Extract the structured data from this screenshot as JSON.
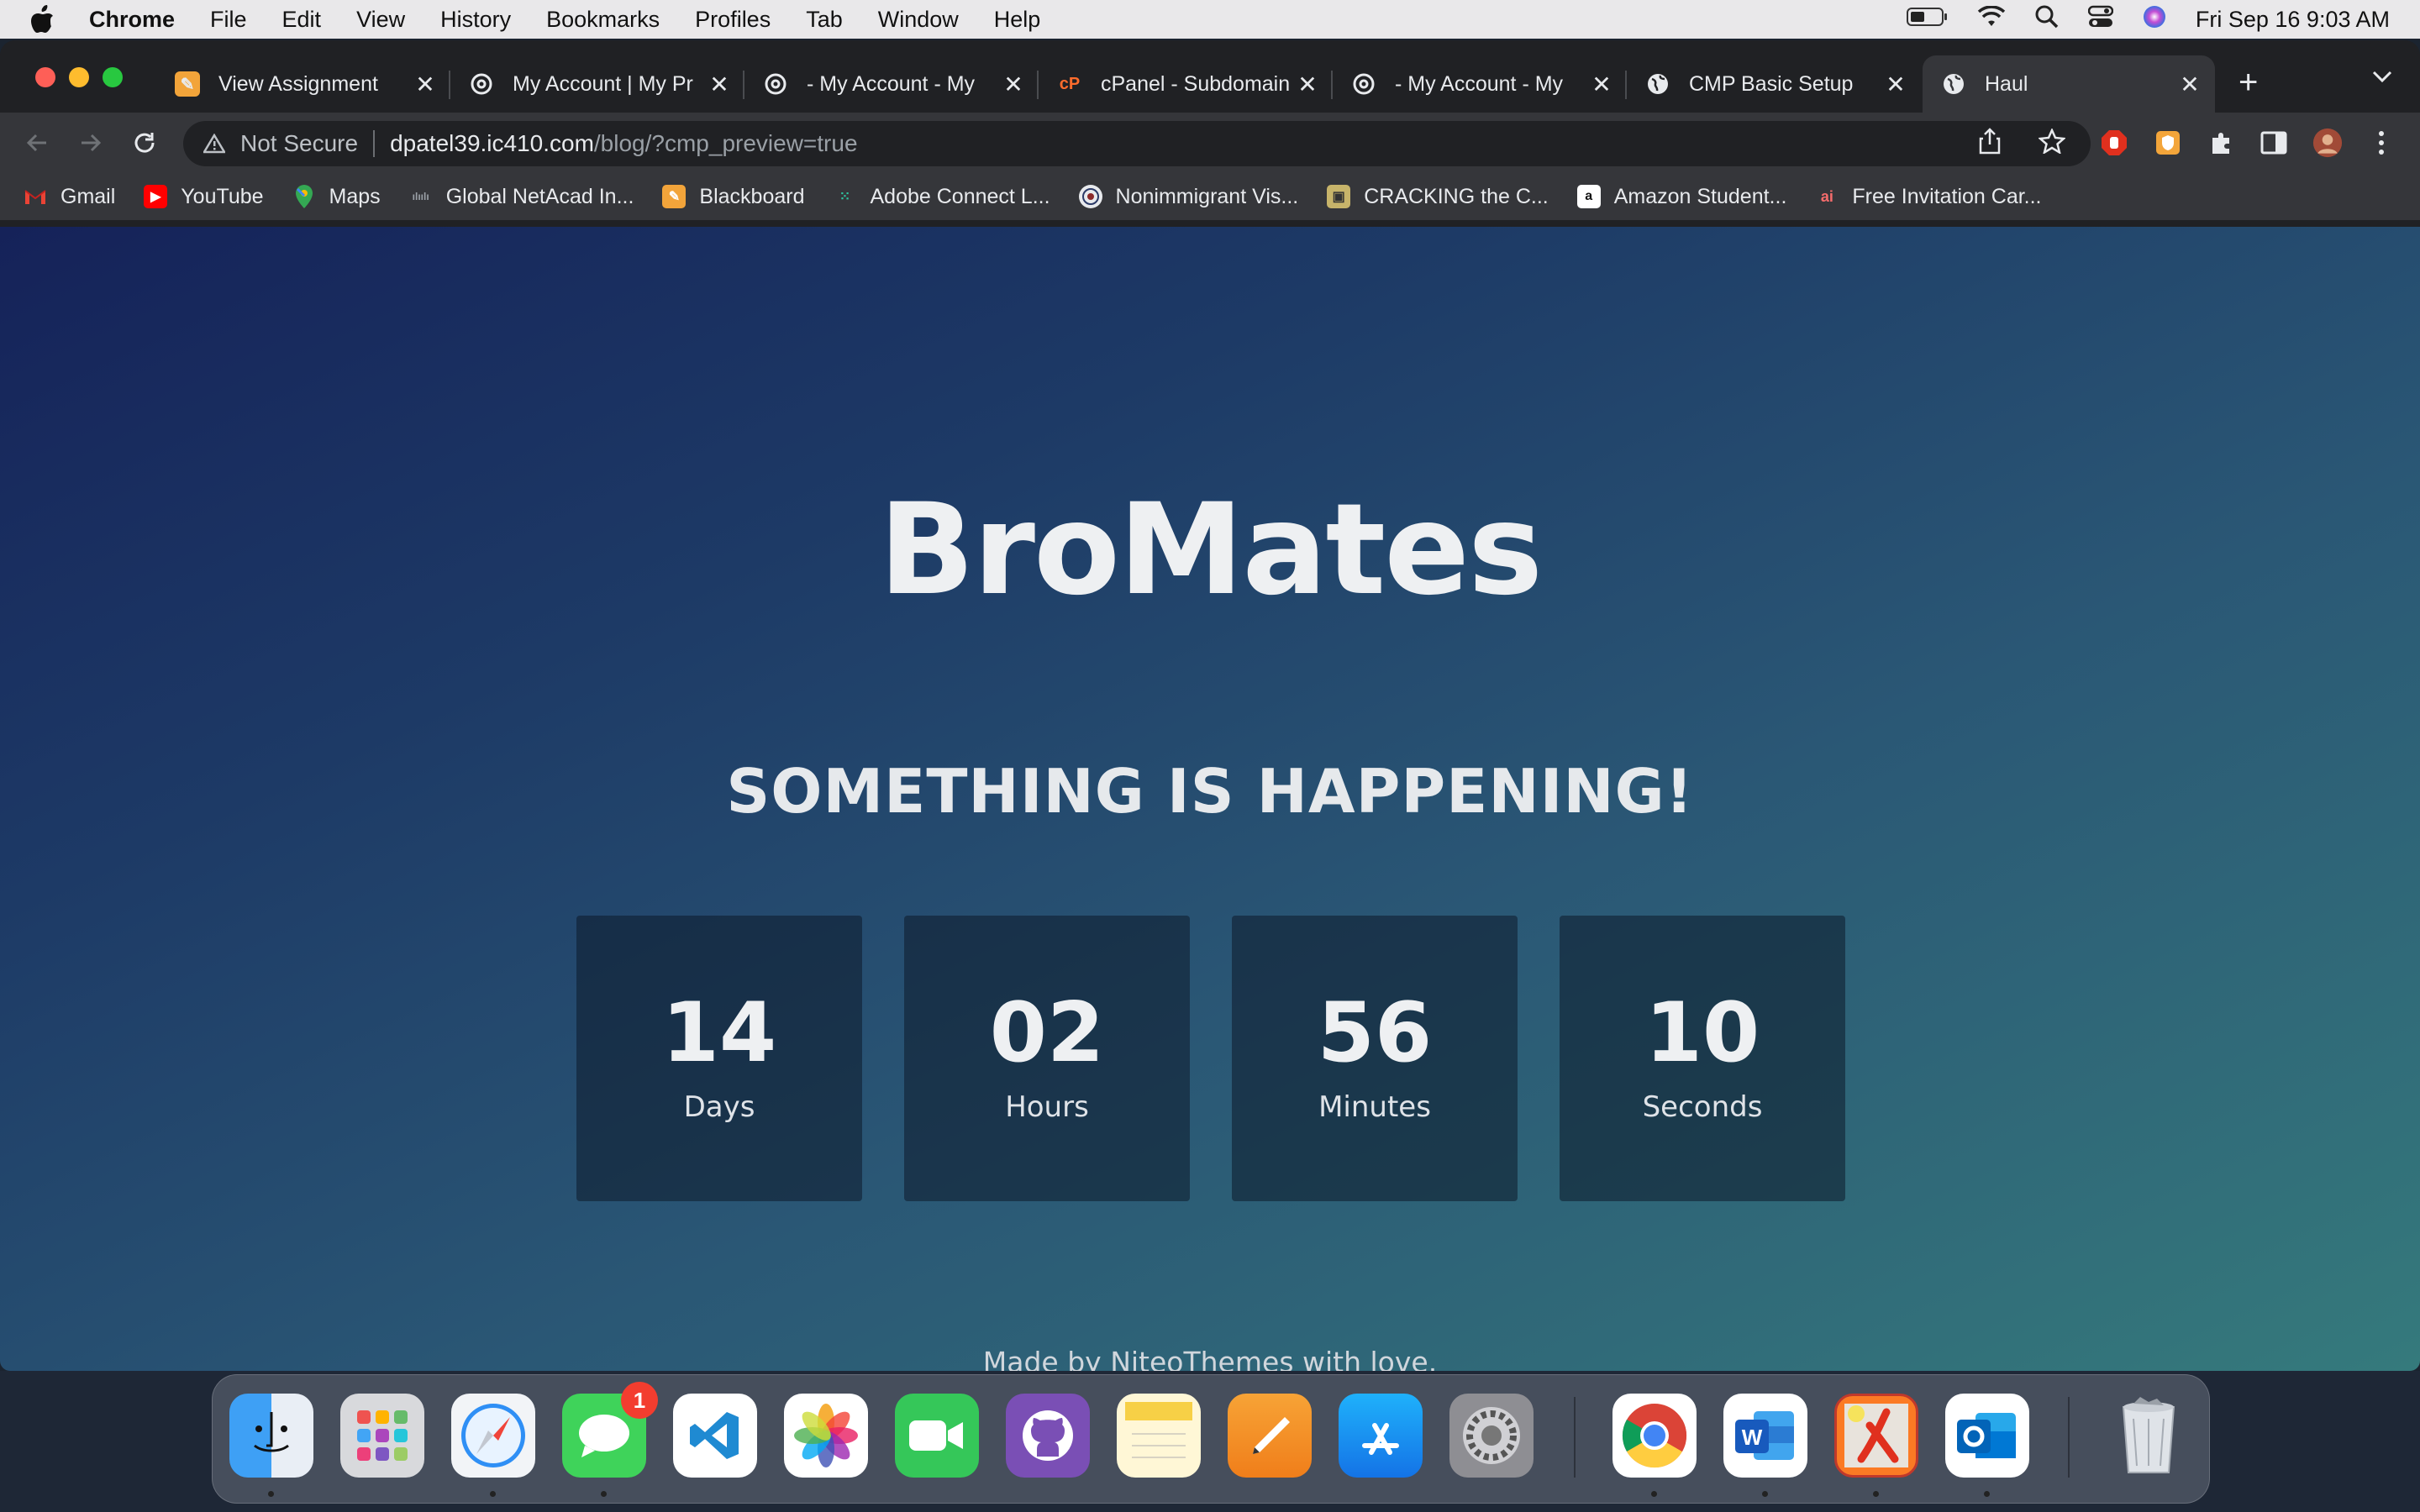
{
  "menubar": {
    "app_name": "Chrome",
    "items": [
      "File",
      "Edit",
      "View",
      "History",
      "Bookmarks",
      "Profiles",
      "Tab",
      "Window",
      "Help"
    ],
    "clock": "Fri Sep 16  9:03 AM"
  },
  "tabs": [
    {
      "title": "View Assignment",
      "icon": "blackboard-icon"
    },
    {
      "title": "My Account | My Pr",
      "icon": "account-icon"
    },
    {
      "title": "- My Account - My",
      "icon": "account-icon"
    },
    {
      "title": "cPanel - Subdomain",
      "icon": "cpanel-icon"
    },
    {
      "title": "- My Account - My",
      "icon": "account-icon"
    },
    {
      "title": "CMP Basic Setup",
      "icon": "globe-icon"
    },
    {
      "title": "Haul",
      "icon": "globe-icon",
      "active": true
    }
  ],
  "omnibox": {
    "security": "Not Secure",
    "host": "dpatel39.ic410.com",
    "path": "/blog/?cmp_preview=true"
  },
  "bookmarks": [
    {
      "label": "Gmail",
      "icon": "gmail-icon"
    },
    {
      "label": "YouTube",
      "icon": "youtube-icon"
    },
    {
      "label": "Maps",
      "icon": "maps-icon"
    },
    {
      "label": "Global NetAcad In...",
      "icon": "cisco-icon"
    },
    {
      "label": "Blackboard",
      "icon": "blackboard-icon"
    },
    {
      "label": "Adobe Connect L...",
      "icon": "adobe-connect-icon"
    },
    {
      "label": "Nonimmigrant Vis...",
      "icon": "seal-icon"
    },
    {
      "label": "CRACKING the C...",
      "icon": "book-icon"
    },
    {
      "label": "Amazon Student...",
      "icon": "amazon-icon"
    },
    {
      "label": "Free Invitation Car...",
      "icon": "invitation-icon"
    }
  ],
  "page": {
    "logo": "BroMates",
    "headline": "SOMETHING IS HAPPENING!",
    "counters": [
      {
        "value": "14",
        "label": "Days"
      },
      {
        "value": "02",
        "label": "Hours"
      },
      {
        "value": "56",
        "label": "Minutes"
      },
      {
        "value": "10",
        "label": "Seconds"
      }
    ],
    "footer_prefix": "Made by",
    "footer_link": "NiteoThemes",
    "footer_suffix": "with love."
  },
  "dock": {
    "messages_badge": "1",
    "apps": [
      "finder-icon",
      "launchpad-icon",
      "safari-icon",
      "messages-icon",
      "vscode-icon",
      "photos-icon",
      "facetime-icon",
      "github-desktop-icon",
      "notes-icon",
      "pages-icon",
      "app-store-icon",
      "system-preferences-icon",
      "chrome-icon",
      "word-icon",
      "xampp-icon",
      "outlook-icon",
      "trash-icon"
    ]
  },
  "colors": {
    "page_gradient_start": "#152259",
    "page_gradient_end": "#357a7c",
    "chrome_dark": "#202124",
    "chrome_toolbar": "#35363a"
  }
}
